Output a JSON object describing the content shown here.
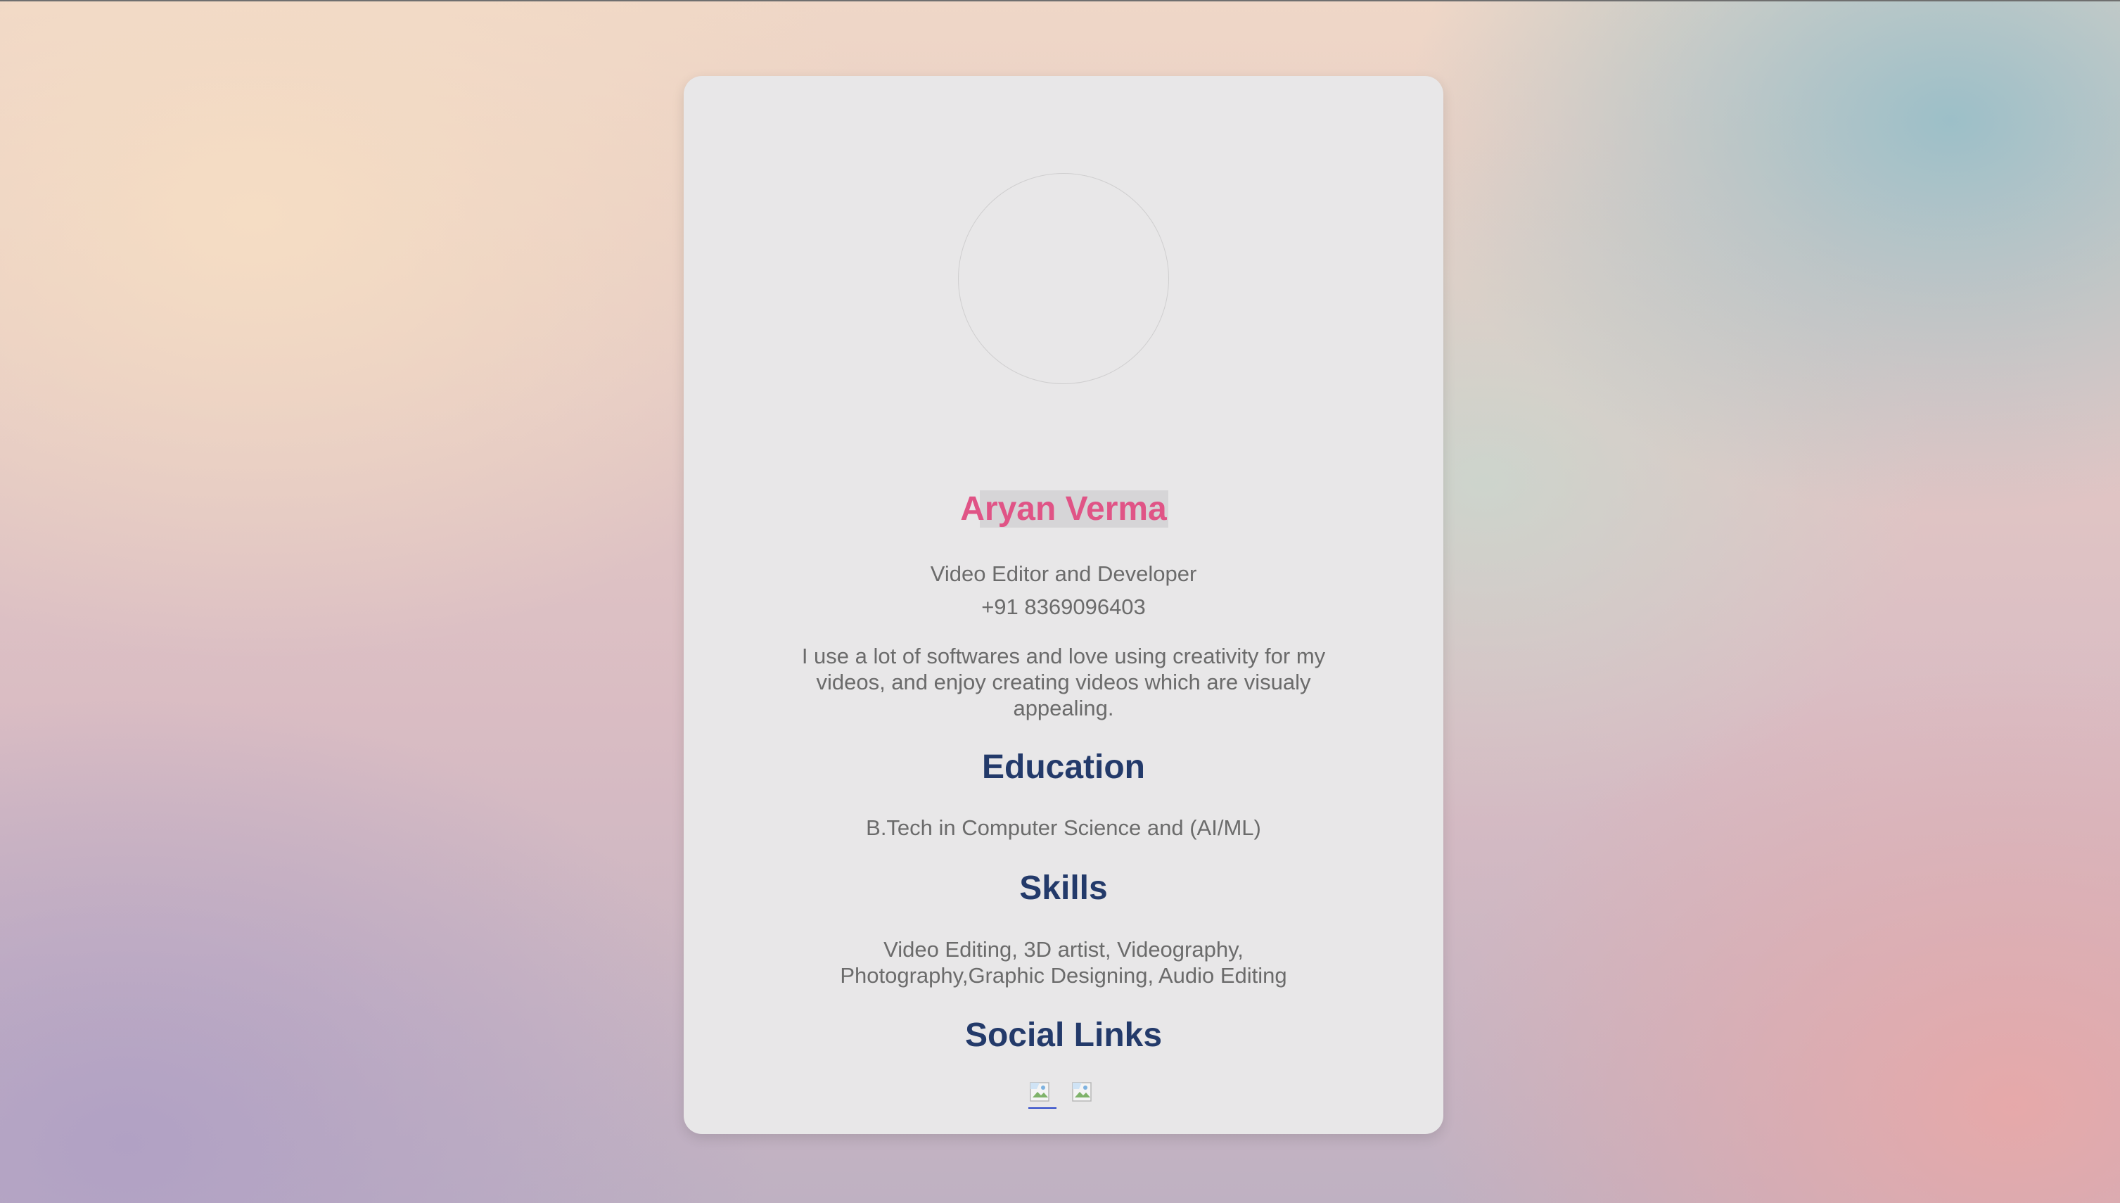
{
  "profile": {
    "name": "Aryan Verma",
    "role": "Video Editor and Developer",
    "phone": "+91 8369096403",
    "bio": "I use a lot of softwares and love using creativity for my videos, and enjoy creating videos which are visualy appealing."
  },
  "education": {
    "title": "Education",
    "text": "B.Tech in Computer Science and (AI/ML)"
  },
  "skills": {
    "title": "Skills",
    "text": "Video Editing, 3D artist, Videography, Photography,Graphic Designing, Audio Editing"
  },
  "social": {
    "title": "Social Links",
    "links": [
      {
        "icon": "broken-image-icon"
      },
      {
        "icon": "broken-image-icon"
      }
    ]
  },
  "colors": {
    "name": "#e05486",
    "heading": "#233a6a",
    "text": "#6b6b6b",
    "card": "#e8e7e8"
  }
}
